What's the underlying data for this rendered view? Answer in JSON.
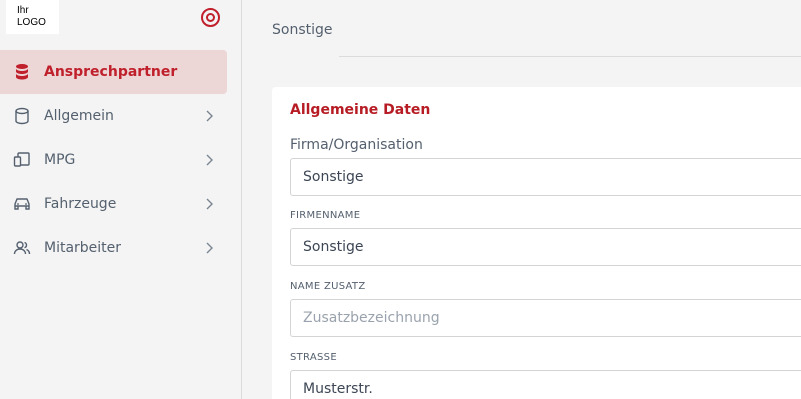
{
  "logo": {
    "line1": "Ihr",
    "line2": "LOGO"
  },
  "sidebar": {
    "items": [
      {
        "label": "Ansprechpartner",
        "icon": "database-icon",
        "active": true
      },
      {
        "label": "Allgemein",
        "icon": "cylinder-icon",
        "active": false
      },
      {
        "label": "MPG",
        "icon": "devices-icon",
        "active": false
      },
      {
        "label": "Fahrzeuge",
        "icon": "car-icon",
        "active": false
      },
      {
        "label": "Mitarbeiter",
        "icon": "users-icon",
        "active": false
      }
    ]
  },
  "main": {
    "section_title": "Sonstige",
    "card": {
      "title": "Allgemeine Daten",
      "fields": [
        {
          "label": "Firma/Organisation",
          "value": "Sonstige",
          "placeholder": ""
        },
        {
          "label": "FIRMENNAME",
          "value": "Sonstige",
          "placeholder": ""
        },
        {
          "label": "NAME ZUSATZ",
          "value": "",
          "placeholder": "Zusatzbezeichnung"
        },
        {
          "label": "STRASSE",
          "value": "Musterstr.",
          "placeholder": ""
        }
      ]
    }
  },
  "colors": {
    "accent": "#c0202b",
    "active_bg": "#ecd6d6",
    "text_muted": "#54606e"
  }
}
